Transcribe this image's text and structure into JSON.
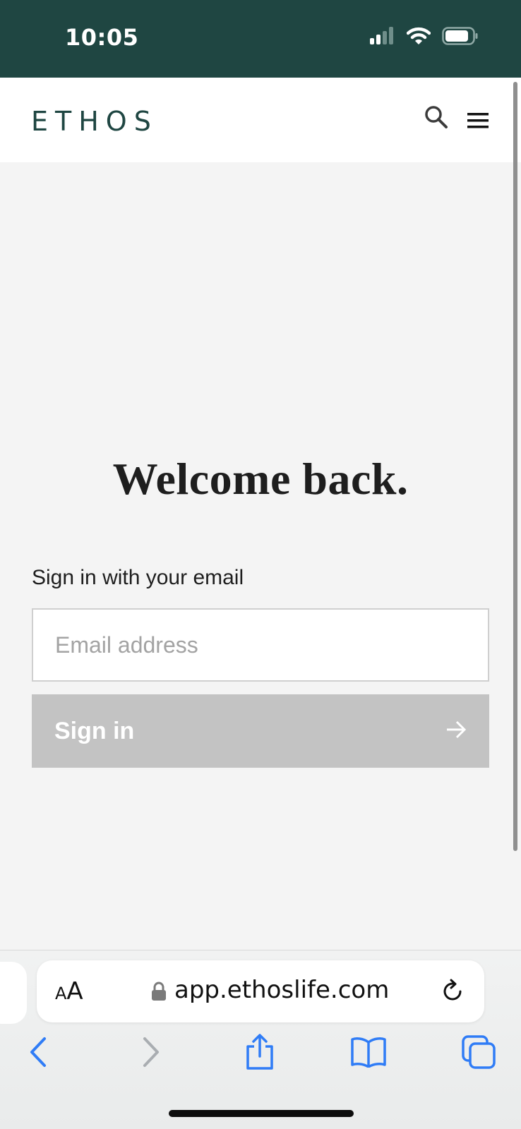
{
  "status_bar": {
    "time": "10:05",
    "icons": [
      "cellular-signal-icon",
      "wifi-icon",
      "battery-icon"
    ]
  },
  "header": {
    "logo": "ETHOS",
    "icons": [
      "search-icon",
      "hamburger-menu-icon"
    ]
  },
  "main": {
    "title": "Welcome back.",
    "signin_label": "Sign in with your email",
    "email_placeholder": "Email address",
    "email_value": "",
    "signin_button_label": "Sign in",
    "signin_button_icon": "arrow-right-icon"
  },
  "safari": {
    "aa_small": "A",
    "aa_large": "A",
    "url": "app.ethoslife.com",
    "toolbar_icons": [
      "back-icon",
      "forward-icon",
      "share-icon",
      "bookmarks-icon",
      "tabs-icon"
    ]
  },
  "colors": {
    "brand": "#1f4642",
    "page_background": "#f4f4f4",
    "button_disabled": "#c3c3c3",
    "safari_accent": "#2f7cf6"
  }
}
